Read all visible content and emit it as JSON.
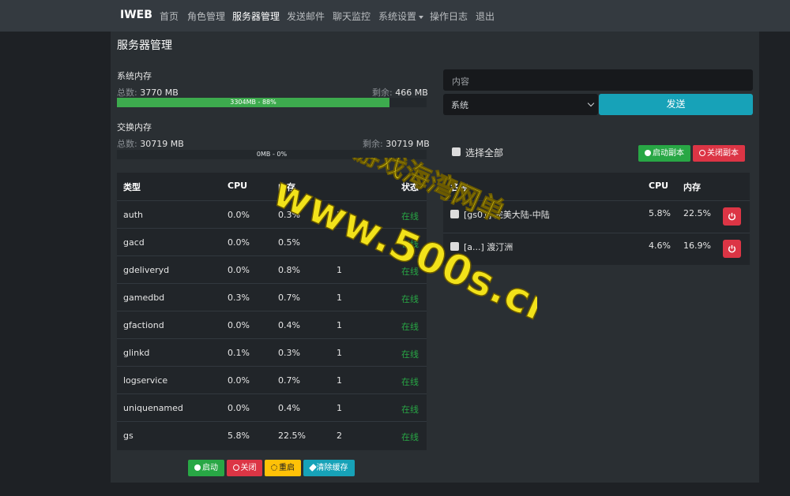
{
  "nav": {
    "brand": "IWEB",
    "items": [
      "首页",
      "角色管理",
      "服务器管理",
      "发送邮件",
      "聊天监控",
      "系统设置",
      "操作日志",
      "退出"
    ]
  },
  "page_title": "服务器管理",
  "memory": {
    "label": "系统内存",
    "total_label": "总数:",
    "total_value": "3770 MB",
    "remain_label": "剩余:",
    "remain_value": "466 MB",
    "bar_text": "3304MB - 88%",
    "fill_fraction": 0.88
  },
  "swap": {
    "label": "交换内存",
    "total_label": "总数:",
    "total_value": "30719 MB",
    "remain_label": "剩余:",
    "remain_value": "30719 MB",
    "bar_text": "0MB - 0%",
    "fill_fraction": 0
  },
  "process_table": {
    "headers": [
      "类型",
      "CPU",
      "内存",
      "",
      "状态"
    ],
    "rows": [
      [
        "auth",
        "0.0%",
        "0.3%",
        "1",
        "在线"
      ],
      [
        "gacd",
        "0.0%",
        "0.5%",
        "",
        "在线"
      ],
      [
        "gdeliveryd",
        "0.0%",
        "0.8%",
        "1",
        "在线"
      ],
      [
        "gamedbd",
        "0.3%",
        "0.7%",
        "1",
        "在线"
      ],
      [
        "gfactiond",
        "0.0%",
        "0.4%",
        "1",
        "在线"
      ],
      [
        "glinkd",
        "0.1%",
        "0.3%",
        "1",
        "在线"
      ],
      [
        "logservice",
        "0.0%",
        "0.7%",
        "1",
        "在线"
      ],
      [
        "uniquenamed",
        "0.0%",
        "0.4%",
        "1",
        "在线"
      ],
      [
        "gs",
        "5.8%",
        "22.5%",
        "2",
        "在线"
      ]
    ]
  },
  "actions": {
    "start": "启动",
    "stop": "关闭",
    "restart": "重启",
    "clear_cache": "清除缓存"
  },
  "message": {
    "placeholder": "内容",
    "select_value": "系统",
    "send": "发送"
  },
  "instances": {
    "select_all": "选择全部",
    "start_instance": "启动副本",
    "stop_instance": "关闭副本",
    "headers": [
      "名称",
      "CPU",
      "内存"
    ],
    "rows": [
      [
        "[gs01] 完美大陆-中陆",
        "5.8%",
        "22.5%"
      ],
      [
        "[a...] 渡汀洲",
        "4.6%",
        "16.9%"
      ]
    ]
  },
  "watermark": {
    "line1": "游戏海湾网单",
    "line2": "www.500s.cn"
  },
  "colors": {
    "success": "#28a745",
    "danger": "#dc3545",
    "warning": "#ffc107",
    "info": "#17a2b8",
    "watermark": "#f2e21a"
  }
}
